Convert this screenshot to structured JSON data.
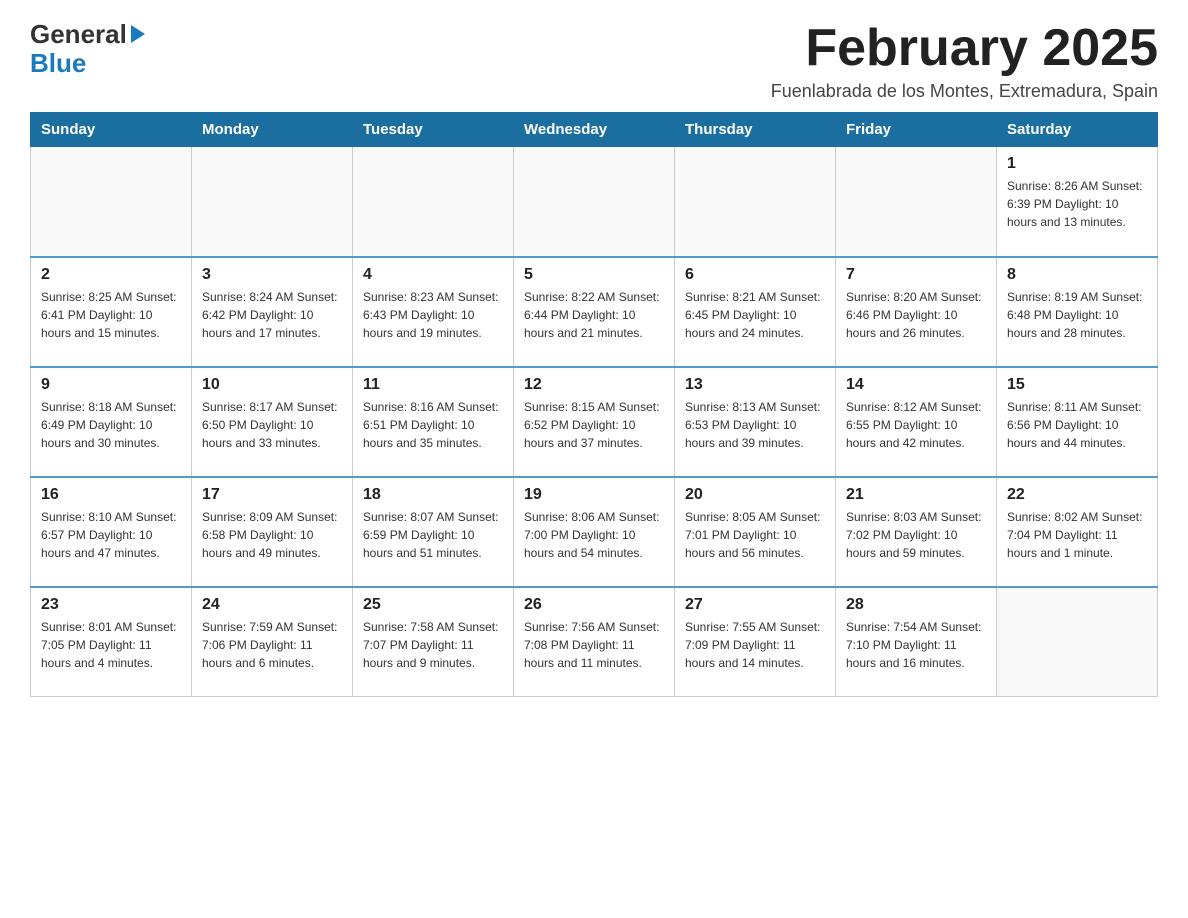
{
  "header": {
    "logo_general": "General",
    "logo_blue": "Blue",
    "month_title": "February 2025",
    "location": "Fuenlabrada de los Montes, Extremadura, Spain"
  },
  "weekdays": [
    "Sunday",
    "Monday",
    "Tuesday",
    "Wednesday",
    "Thursday",
    "Friday",
    "Saturday"
  ],
  "weeks": [
    {
      "days": [
        {
          "num": "",
          "info": ""
        },
        {
          "num": "",
          "info": ""
        },
        {
          "num": "",
          "info": ""
        },
        {
          "num": "",
          "info": ""
        },
        {
          "num": "",
          "info": ""
        },
        {
          "num": "",
          "info": ""
        },
        {
          "num": "1",
          "info": "Sunrise: 8:26 AM\nSunset: 6:39 PM\nDaylight: 10 hours\nand 13 minutes."
        }
      ]
    },
    {
      "days": [
        {
          "num": "2",
          "info": "Sunrise: 8:25 AM\nSunset: 6:41 PM\nDaylight: 10 hours\nand 15 minutes."
        },
        {
          "num": "3",
          "info": "Sunrise: 8:24 AM\nSunset: 6:42 PM\nDaylight: 10 hours\nand 17 minutes."
        },
        {
          "num": "4",
          "info": "Sunrise: 8:23 AM\nSunset: 6:43 PM\nDaylight: 10 hours\nand 19 minutes."
        },
        {
          "num": "5",
          "info": "Sunrise: 8:22 AM\nSunset: 6:44 PM\nDaylight: 10 hours\nand 21 minutes."
        },
        {
          "num": "6",
          "info": "Sunrise: 8:21 AM\nSunset: 6:45 PM\nDaylight: 10 hours\nand 24 minutes."
        },
        {
          "num": "7",
          "info": "Sunrise: 8:20 AM\nSunset: 6:46 PM\nDaylight: 10 hours\nand 26 minutes."
        },
        {
          "num": "8",
          "info": "Sunrise: 8:19 AM\nSunset: 6:48 PM\nDaylight: 10 hours\nand 28 minutes."
        }
      ]
    },
    {
      "days": [
        {
          "num": "9",
          "info": "Sunrise: 8:18 AM\nSunset: 6:49 PM\nDaylight: 10 hours\nand 30 minutes."
        },
        {
          "num": "10",
          "info": "Sunrise: 8:17 AM\nSunset: 6:50 PM\nDaylight: 10 hours\nand 33 minutes."
        },
        {
          "num": "11",
          "info": "Sunrise: 8:16 AM\nSunset: 6:51 PM\nDaylight: 10 hours\nand 35 minutes."
        },
        {
          "num": "12",
          "info": "Sunrise: 8:15 AM\nSunset: 6:52 PM\nDaylight: 10 hours\nand 37 minutes."
        },
        {
          "num": "13",
          "info": "Sunrise: 8:13 AM\nSunset: 6:53 PM\nDaylight: 10 hours\nand 39 minutes."
        },
        {
          "num": "14",
          "info": "Sunrise: 8:12 AM\nSunset: 6:55 PM\nDaylight: 10 hours\nand 42 minutes."
        },
        {
          "num": "15",
          "info": "Sunrise: 8:11 AM\nSunset: 6:56 PM\nDaylight: 10 hours\nand 44 minutes."
        }
      ]
    },
    {
      "days": [
        {
          "num": "16",
          "info": "Sunrise: 8:10 AM\nSunset: 6:57 PM\nDaylight: 10 hours\nand 47 minutes."
        },
        {
          "num": "17",
          "info": "Sunrise: 8:09 AM\nSunset: 6:58 PM\nDaylight: 10 hours\nand 49 minutes."
        },
        {
          "num": "18",
          "info": "Sunrise: 8:07 AM\nSunset: 6:59 PM\nDaylight: 10 hours\nand 51 minutes."
        },
        {
          "num": "19",
          "info": "Sunrise: 8:06 AM\nSunset: 7:00 PM\nDaylight: 10 hours\nand 54 minutes."
        },
        {
          "num": "20",
          "info": "Sunrise: 8:05 AM\nSunset: 7:01 PM\nDaylight: 10 hours\nand 56 minutes."
        },
        {
          "num": "21",
          "info": "Sunrise: 8:03 AM\nSunset: 7:02 PM\nDaylight: 10 hours\nand 59 minutes."
        },
        {
          "num": "22",
          "info": "Sunrise: 8:02 AM\nSunset: 7:04 PM\nDaylight: 11 hours\nand 1 minute."
        }
      ]
    },
    {
      "days": [
        {
          "num": "23",
          "info": "Sunrise: 8:01 AM\nSunset: 7:05 PM\nDaylight: 11 hours\nand 4 minutes."
        },
        {
          "num": "24",
          "info": "Sunrise: 7:59 AM\nSunset: 7:06 PM\nDaylight: 11 hours\nand 6 minutes."
        },
        {
          "num": "25",
          "info": "Sunrise: 7:58 AM\nSunset: 7:07 PM\nDaylight: 11 hours\nand 9 minutes."
        },
        {
          "num": "26",
          "info": "Sunrise: 7:56 AM\nSunset: 7:08 PM\nDaylight: 11 hours\nand 11 minutes."
        },
        {
          "num": "27",
          "info": "Sunrise: 7:55 AM\nSunset: 7:09 PM\nDaylight: 11 hours\nand 14 minutes."
        },
        {
          "num": "28",
          "info": "Sunrise: 7:54 AM\nSunset: 7:10 PM\nDaylight: 11 hours\nand 16 minutes."
        },
        {
          "num": "",
          "info": ""
        }
      ]
    }
  ]
}
